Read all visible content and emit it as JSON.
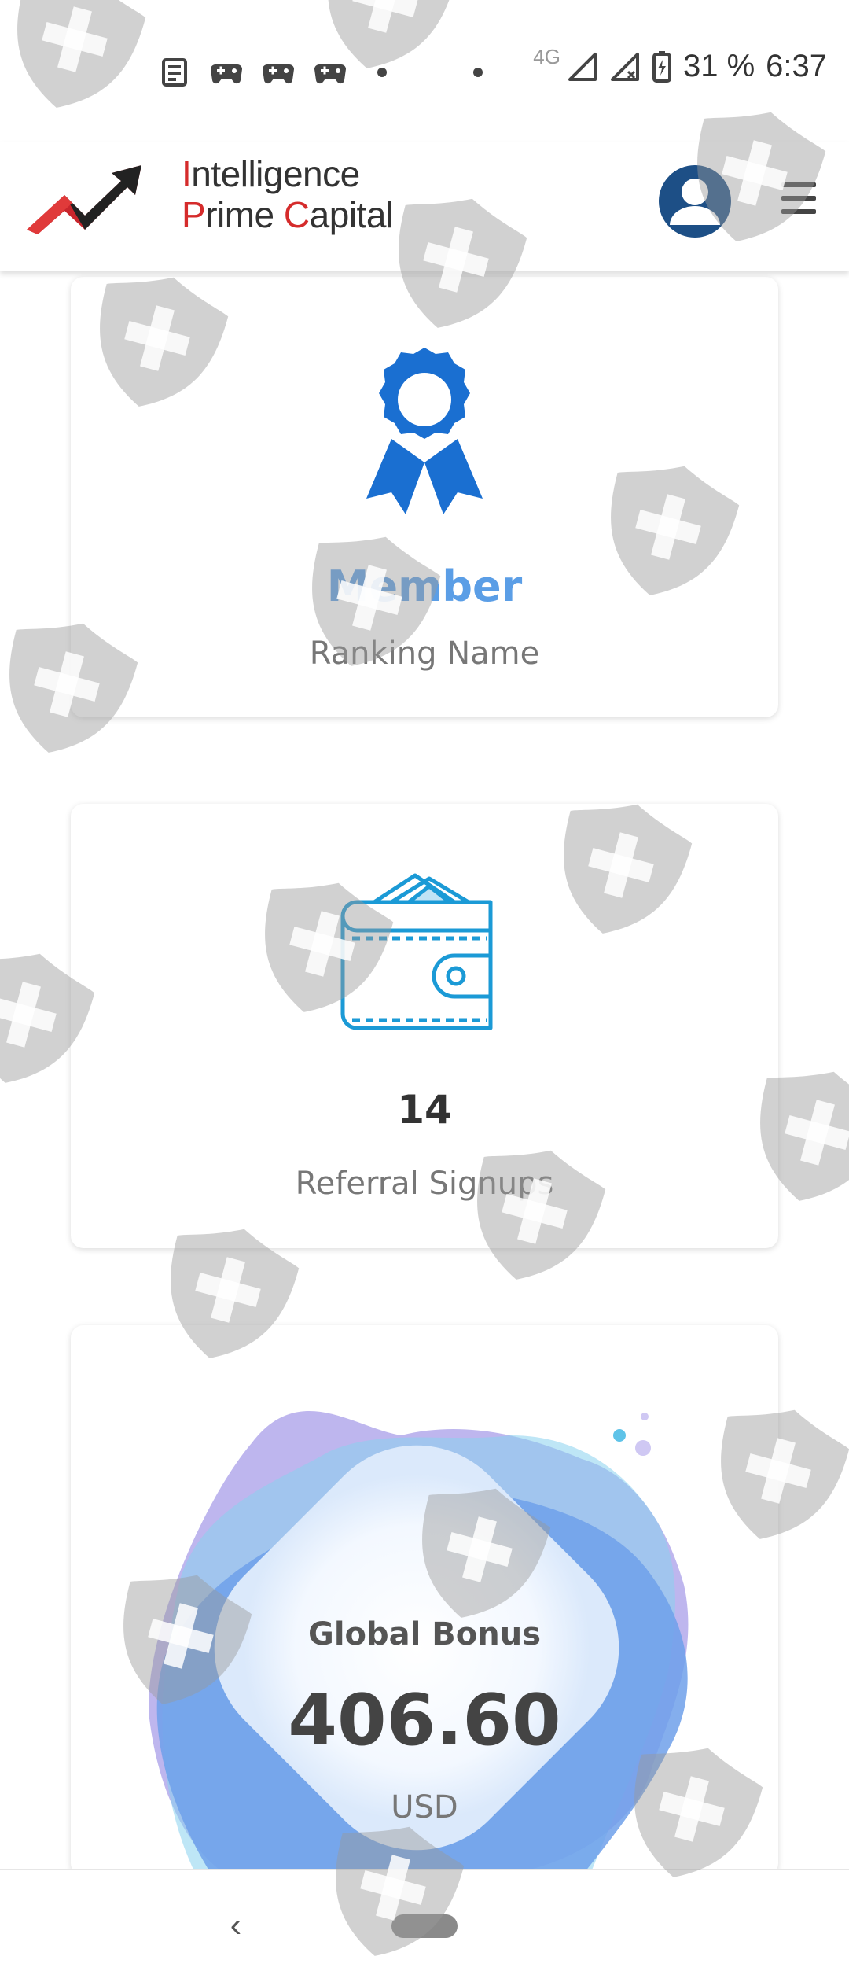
{
  "status_bar": {
    "network": "4G",
    "battery": "31 %",
    "time": "6:37",
    "icons": [
      "news-icon",
      "game-controller-icon",
      "game-controller-icon",
      "game-controller-icon",
      "dot-icon",
      "dot-icon",
      "signal-icon",
      "signal-no-service-icon",
      "battery-charging-icon"
    ]
  },
  "header": {
    "brand_line1_first": "I",
    "brand_line1_rest": "ntelligence",
    "brand_line2_a": "P",
    "brand_line2_b": "rime ",
    "brand_line2_c": "C",
    "brand_line2_d": "apital",
    "brand_accent": "#d52b2b",
    "avatar_icon": "user-avatar-icon",
    "menu_icon": "hamburger-menu-icon"
  },
  "cards": {
    "ranking": {
      "icon": "award-ribbon-icon",
      "value": "Member",
      "label": "Ranking Name",
      "value_color": "#5b9ee6"
    },
    "referral": {
      "icon": "wallet-icon",
      "value": "14",
      "label": "Referral Signups"
    },
    "global_bonus": {
      "title": "Global Bonus",
      "value": "406.60",
      "unit": "USD"
    }
  },
  "nav": {
    "back_icon": "back-chevron-icon",
    "home_icon": "home-pill-icon",
    "back_glyph": "‹"
  }
}
